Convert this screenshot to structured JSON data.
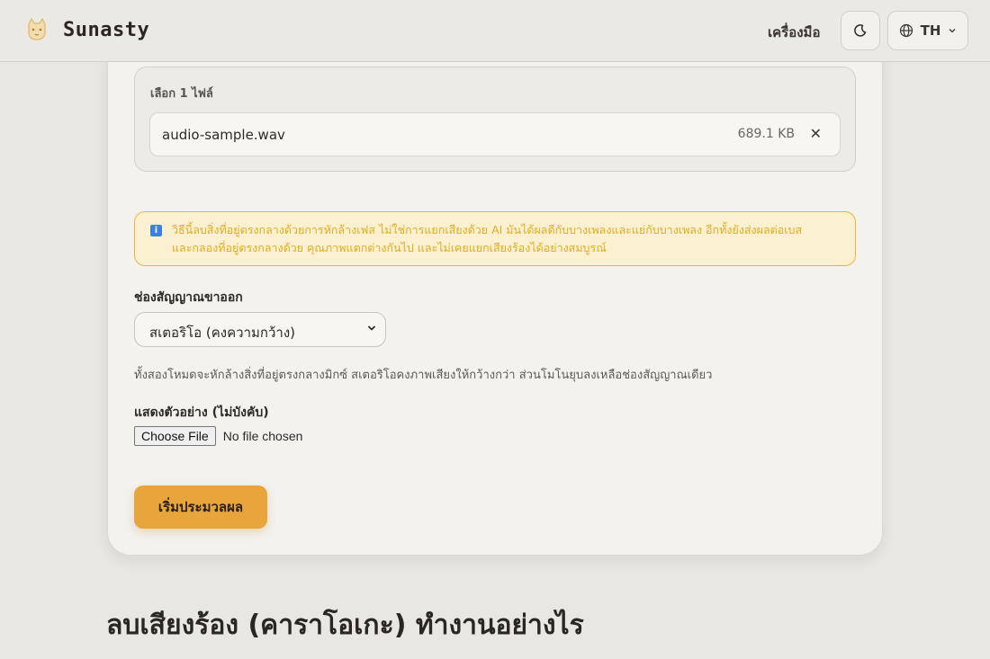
{
  "header": {
    "brand": "Sunasty",
    "nav_tools": "เครื่องมือ",
    "language": "TH"
  },
  "upload": {
    "selected_count": "เลือก 1 ไฟล์",
    "file_name": "audio-sample.wav",
    "file_size": "689.1 KB",
    "remove_symbol": "✕"
  },
  "notice": {
    "line1": "วิธีนี้ลบสิ่งที่อยู่ตรงกลางด้วยการหักล้างเฟส ไม่ใช่การแยกเสียงด้วย AI มันได้ผลดีกับบางเพลงและแย่กับบางเพลง อีกทั้งยังส่งผลต่อเบส",
    "line2": "และกลองที่อยู่ตรงกลางด้วย คุณภาพแตกต่างกันไป และไม่เคยแยกเสียงร้องได้อย่างสมบูรณ์"
  },
  "output": {
    "label": "ช่องสัญญาณขาออก",
    "selected_option": "สเตอริโอ (คงความกว้าง)",
    "hint": "ทั้งสองโหมดจะหักล้างสิ่งที่อยู่ตรงกลางมิกซ์ สเตอริโอคงภาพเสียงให้กว้างกว่า ส่วนโมโนยุบลงเหลือช่องสัญญาณเดียว"
  },
  "preview": {
    "label": "แสดงตัวอย่าง (ไม่บังคับ)",
    "choose_file": "Choose File",
    "no_file": "No file chosen"
  },
  "actions": {
    "start": "เริ่มประมวลผล"
  },
  "section": {
    "title": "ลบเสียงร้อง (คาราโอเกะ) ทำงานอย่างไร"
  },
  "colors": {
    "accent": "#e8a53c",
    "notice_text": "#e0ac23",
    "notice_bg": "#fbf0cf"
  }
}
